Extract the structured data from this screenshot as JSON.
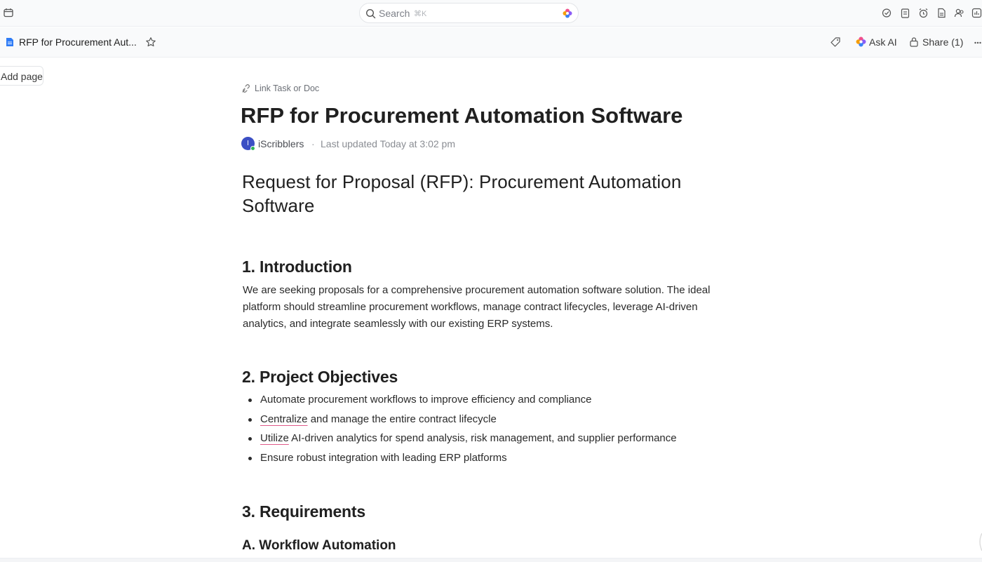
{
  "topbar": {
    "search_label": "Search",
    "search_shortcut": "⌘K"
  },
  "docbar": {
    "doc_title": "RFP for Procurement Aut...",
    "ask_ai_label": "Ask AI",
    "share_label": "Share (1)"
  },
  "sidebar": {
    "add_page_label": "Add page"
  },
  "doc": {
    "link_label": "Link Task or Doc",
    "title": "RFP for Procurement Automation Software",
    "avatar_initial": "I",
    "author": "iScribblers",
    "separator": "·",
    "last_updated": "Last updated Today at 3:02 pm",
    "heading": "Request for Proposal (RFP): Procurement Automation Software",
    "sections": {
      "intro_title": "1. Introduction",
      "intro_body": "We are seeking proposals for a comprehensive procurement automation software solution. The ideal platform should streamline procurement workflows, manage contract lifecycles, leverage AI-driven analytics, and integrate seamlessly with our existing ERP systems.",
      "objectives_title": "2. Project Objectives",
      "objectives": [
        {
          "lead": "",
          "rest": "Automate procurement workflows to improve efficiency and compliance"
        },
        {
          "lead": "Centralize",
          "rest": " and manage the entire contract lifecycle"
        },
        {
          "lead": "Utilize",
          "rest": " AI-driven analytics for spend analysis, risk management, and supplier performance"
        },
        {
          "lead": "",
          "rest": "Ensure robust integration with leading ERP platforms"
        }
      ],
      "requirements_title": "3. Requirements",
      "workflow_title": "A. Workflow Automation"
    }
  },
  "icons": {
    "calendar": "calendar-icon",
    "search": "search-icon",
    "ai": "ai-sparkle-icon",
    "doc": "document-icon",
    "star": "star-icon",
    "tag": "tag-icon",
    "lock": "lock-icon",
    "more": "more-horizontal-icon",
    "link": "link-icon"
  },
  "colors": {
    "accent_blue": "#2f7cf6",
    "avatar": "#3b4fc4",
    "online": "#2fb45a",
    "spellcheck": "#e05a8a"
  }
}
